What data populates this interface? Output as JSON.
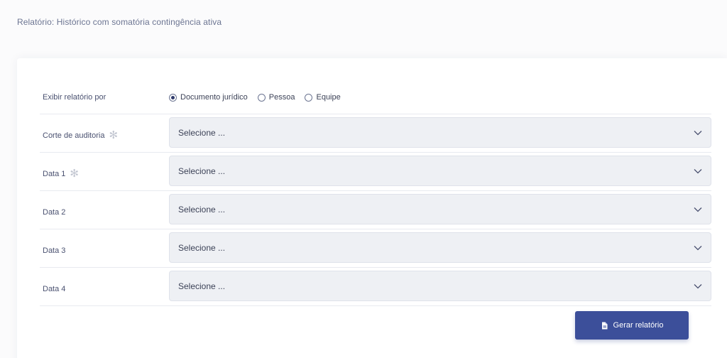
{
  "page": {
    "title": "Relatório: Histórico com somatória contingência ativa"
  },
  "form": {
    "display_by": {
      "label": "Exibir relatório por",
      "options": [
        {
          "label": "Documento jurídico",
          "checked": true
        },
        {
          "label": "Pessoa",
          "checked": false
        },
        {
          "label": "Equipe",
          "checked": false
        }
      ]
    },
    "fields": [
      {
        "label": "Corte de auditoria",
        "required": true,
        "value": "Selecione ..."
      },
      {
        "label": "Data 1",
        "required": true,
        "value": "Selecione ..."
      },
      {
        "label": "Data 2",
        "required": false,
        "value": "Selecione ..."
      },
      {
        "label": "Data 3",
        "required": false,
        "value": "Selecione ..."
      },
      {
        "label": "Data 4",
        "required": false,
        "value": "Selecione ..."
      }
    ],
    "required_marker": "✻",
    "generate_button": {
      "label": "Gerar relatório",
      "icon": "document-icon"
    }
  },
  "colors": {
    "primary": "#3c4f9a",
    "select_bg": "#eef0f4",
    "divider": "#e8eaf0",
    "muted_text": "#6c7592"
  }
}
